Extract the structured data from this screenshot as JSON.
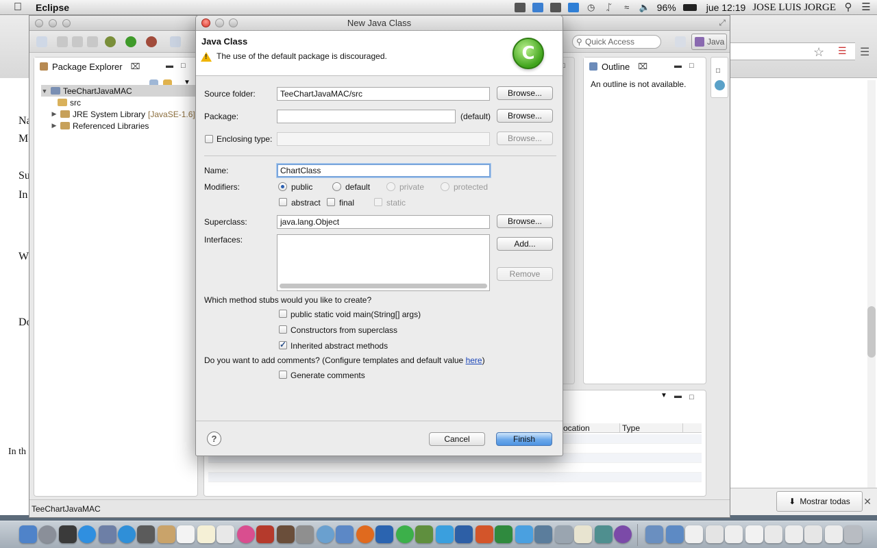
{
  "menubar": {
    "app_name": "Eclipse",
    "battery": "96%",
    "clock": "jue 12:19",
    "user": "JOSE LUIS JORGE"
  },
  "eclipse": {
    "quick_access_placeholder": "Quick Access",
    "perspective": "Java",
    "package_explorer": {
      "tab_label": "Package Explorer",
      "tree": [
        {
          "label": "TeeChartJavaMAC",
          "expanded": true
        },
        {
          "label": "src"
        },
        {
          "label": "JRE System Library",
          "suffix": "[JavaSE-1.6]"
        },
        {
          "label": "Referenced Libraries"
        }
      ]
    },
    "outline": {
      "tab_label": "Outline",
      "message": "An outline is not available."
    },
    "problems": {
      "columns": [
        "ocation",
        "Type"
      ]
    },
    "status_bar": "TeeChartJavaMAC"
  },
  "browser": {
    "download_button": "Mostrar todas",
    "left_text": [
      "Na",
      "Mo",
      "Su",
      "In",
      "W",
      "Do",
      "In th"
    ]
  },
  "dialog": {
    "window_title": "New Java Class",
    "heading": "Java Class",
    "message": "The use of the default package is discouraged.",
    "source_folder_label": "Source folder:",
    "source_folder_value": "TeeChartJavaMAC/src",
    "package_label": "Package:",
    "package_value": "",
    "package_default": "(default)",
    "enclosing_label": "Enclosing type:",
    "enclosing_value": "",
    "browse_label": "Browse...",
    "name_label": "Name:",
    "name_value": "ChartClass",
    "modifiers_label": "Modifiers:",
    "modifiers": {
      "access": [
        {
          "label": "public",
          "selected": true,
          "enabled": true
        },
        {
          "label": "default",
          "selected": false,
          "enabled": true
        },
        {
          "label": "private",
          "selected": false,
          "enabled": false
        },
        {
          "label": "protected",
          "selected": false,
          "enabled": false
        }
      ],
      "other": [
        {
          "label": "abstract",
          "checked": false,
          "enabled": true
        },
        {
          "label": "final",
          "checked": false,
          "enabled": true
        },
        {
          "label": "static",
          "checked": false,
          "enabled": false
        }
      ]
    },
    "superclass_label": "Superclass:",
    "superclass_value": "java.lang.Object",
    "interfaces_label": "Interfaces:",
    "add_label": "Add...",
    "remove_label": "Remove",
    "stubs_question": "Which method stubs would you like to create?",
    "stubs": [
      {
        "label": "public static void main(String[] args)",
        "checked": false
      },
      {
        "label": "Constructors from superclass",
        "checked": false
      },
      {
        "label": "Inherited abstract methods",
        "checked": true
      }
    ],
    "comments_question_prefix": "Do you want to add comments? (Configure templates and default value ",
    "comments_link": "here",
    "comments_question_suffix": ")",
    "generate_comments_label": "Generate comments",
    "generate_comments_checked": false,
    "help_glyph": "?",
    "cancel_label": "Cancel",
    "finish_label": "Finish"
  },
  "colors": {
    "finish_button": "#5b9ee6",
    "logo_green": "#3fa31b",
    "warning": "#f0b400"
  }
}
